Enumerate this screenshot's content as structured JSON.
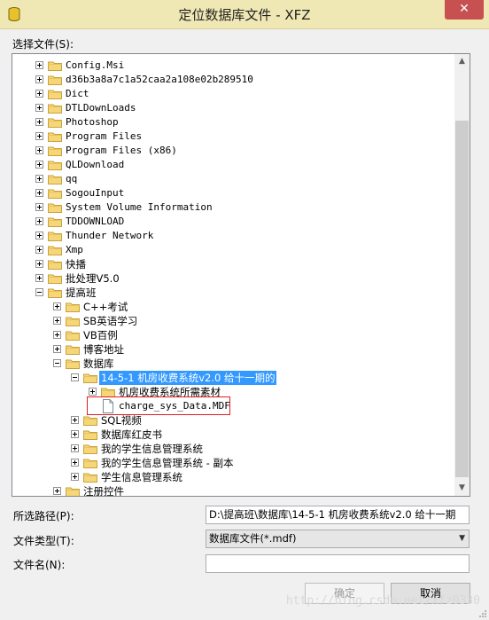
{
  "window": {
    "title": "定位数据库文件 - XFZ",
    "close_glyph": "✕"
  },
  "select_file_label": "选择文件(S):",
  "tree": [
    {
      "label": "Config.Msi",
      "level": 1,
      "toggle": "plus",
      "icon": "folder"
    },
    {
      "label": "d36b3a8a7c1a52caa2a108e02b289510",
      "level": 1,
      "toggle": "plus",
      "icon": "folder"
    },
    {
      "label": "Dict",
      "level": 1,
      "toggle": "plus",
      "icon": "folder"
    },
    {
      "label": "DTLDownLoads",
      "level": 1,
      "toggle": "plus",
      "icon": "folder"
    },
    {
      "label": "Photoshop",
      "level": 1,
      "toggle": "plus",
      "icon": "folder"
    },
    {
      "label": "Program Files",
      "level": 1,
      "toggle": "plus",
      "icon": "folder"
    },
    {
      "label": "Program Files (x86)",
      "level": 1,
      "toggle": "plus",
      "icon": "folder"
    },
    {
      "label": "QLDownload",
      "level": 1,
      "toggle": "plus",
      "icon": "folder"
    },
    {
      "label": "qq",
      "level": 1,
      "toggle": "plus",
      "icon": "folder"
    },
    {
      "label": "SogouInput",
      "level": 1,
      "toggle": "plus",
      "icon": "folder"
    },
    {
      "label": "System Volume Information",
      "level": 1,
      "toggle": "plus",
      "icon": "folder"
    },
    {
      "label": "TDDOWNLOAD",
      "level": 1,
      "toggle": "plus",
      "icon": "folder"
    },
    {
      "label": "Thunder Network",
      "level": 1,
      "toggle": "plus",
      "icon": "folder"
    },
    {
      "label": "Xmp",
      "level": 1,
      "toggle": "plus",
      "icon": "folder"
    },
    {
      "label": "快播",
      "level": 1,
      "toggle": "plus",
      "icon": "folder"
    },
    {
      "label": "批处理V5.0",
      "level": 1,
      "toggle": "plus",
      "icon": "folder"
    },
    {
      "label": "提高班",
      "level": 1,
      "toggle": "minus",
      "icon": "folder"
    },
    {
      "label": "C++考试",
      "level": 2,
      "toggle": "plus",
      "icon": "folder"
    },
    {
      "label": "SB英语学习",
      "level": 2,
      "toggle": "plus",
      "icon": "folder"
    },
    {
      "label": "VB百例",
      "level": 2,
      "toggle": "plus",
      "icon": "folder"
    },
    {
      "label": "博客地址",
      "level": 2,
      "toggle": "plus",
      "icon": "folder"
    },
    {
      "label": "数据库",
      "level": 2,
      "toggle": "minus",
      "icon": "folder"
    },
    {
      "label": "14-5-1 机房收费系统v2.0 给十一期的",
      "level": 3,
      "toggle": "minus",
      "icon": "folder",
      "selected": true
    },
    {
      "label": "机房收费系统所需素材",
      "level": 4,
      "toggle": "plus",
      "icon": "folder"
    },
    {
      "label": "charge_sys_Data.MDF",
      "level": 4,
      "toggle": "none",
      "icon": "file"
    },
    {
      "label": "SQL视频",
      "level": 3,
      "toggle": "plus",
      "icon": "folder"
    },
    {
      "label": "数据库红皮书",
      "level": 3,
      "toggle": "plus",
      "icon": "folder"
    },
    {
      "label": "我的学生信息管理系统",
      "level": 3,
      "toggle": "plus",
      "icon": "folder"
    },
    {
      "label": "我的学生信息管理系统 - 副本",
      "level": 3,
      "toggle": "plus",
      "icon": "folder"
    },
    {
      "label": "学生信息管理系统",
      "level": 3,
      "toggle": "plus",
      "icon": "folder"
    },
    {
      "label": "注册控件",
      "level": 2,
      "toggle": "plus",
      "icon": "folder"
    }
  ],
  "form": {
    "path_label": "所选路径(P):",
    "path_value": "D:\\提高班\\数据库\\14-5-1 机房收费系统v2.0 给十一期",
    "type_label": "文件类型(T):",
    "type_value": "数据库文件(*.mdf)",
    "name_label": "文件名(N):",
    "name_value": ""
  },
  "buttons": {
    "ok": "确定",
    "cancel": "取消"
  },
  "watermark": "http://blog.csdn.net/xfz0330",
  "colors": {
    "titlebar": "#f0e8b4",
    "selection": "#3399ff",
    "close": "#c75050",
    "highlight_border": "#e02020"
  }
}
